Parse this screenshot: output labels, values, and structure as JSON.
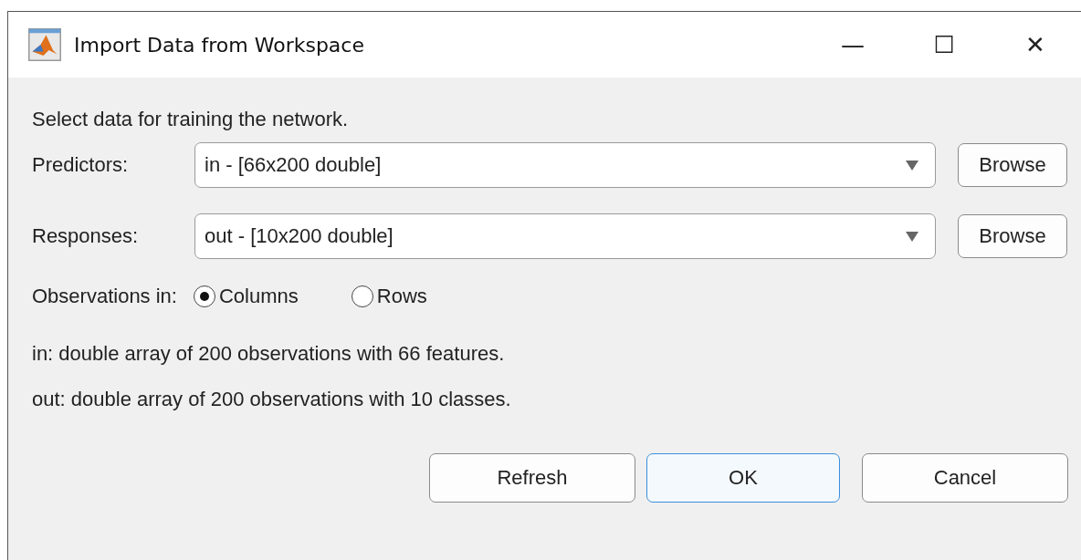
{
  "window": {
    "title": "Import Data from Workspace",
    "controls": [
      "—",
      "☐",
      "✕"
    ]
  },
  "intro": "Select data for training the network.",
  "fields": [
    {
      "label": "Predictors:",
      "value": "in - [66x200 double]",
      "button": "Browse"
    },
    {
      "label": "Responses:",
      "value": "out - [10x200 double]",
      "button": "Browse"
    }
  ],
  "observations": {
    "label": "Observations in:",
    "options": [
      {
        "label": "Columns",
        "selected": true
      },
      {
        "label": "Rows",
        "selected": false
      }
    ]
  },
  "info": [
    "in: double array of 200 observations with 66 features.",
    "out: double array of 200 observations with 10 classes."
  ],
  "buttons": [
    {
      "label": "Refresh",
      "kind": "normal"
    },
    {
      "label": "OK",
      "kind": "default"
    },
    {
      "label": "Cancel",
      "kind": "normal"
    }
  ]
}
